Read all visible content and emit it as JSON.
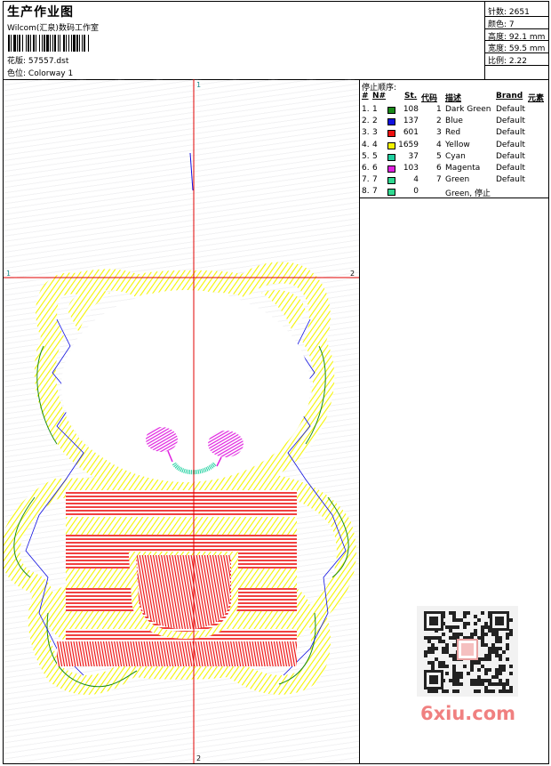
{
  "header": {
    "title": "生产作业图",
    "company": "Wilcom(汇泉)数码工作室",
    "design_label": "花版:",
    "design_value": "57557.dst",
    "color_label": "色位:",
    "color_value": "Colorway 1"
  },
  "stats": [
    {
      "label": "针数:",
      "value": "2651"
    },
    {
      "label": "颜色:",
      "value": "7"
    },
    {
      "label": "高度:",
      "value": "92.1 mm"
    },
    {
      "label": "宽度:",
      "value": "59.5 mm"
    },
    {
      "label": "比例:",
      "value": "2.22"
    }
  ],
  "stop_sequence": {
    "title": "停止顺序:",
    "headers": {
      "num": "#",
      "n": "N#",
      "st": "St.",
      "code": "代码",
      "desc": "描述",
      "brand": "Brand",
      "element": "元素"
    },
    "rows": [
      {
        "num": "1.",
        "n": "1",
        "color": "#1a8a1a",
        "st": "108",
        "code": "1",
        "desc": "Dark Green",
        "brand": "Default"
      },
      {
        "num": "2.",
        "n": "2",
        "color": "#1010e0",
        "st": "137",
        "code": "2",
        "desc": "Blue",
        "brand": "Default"
      },
      {
        "num": "3.",
        "n": "3",
        "color": "#ee1010",
        "st": "601",
        "code": "3",
        "desc": "Red",
        "brand": "Default"
      },
      {
        "num": "4.",
        "n": "4",
        "color": "#f4f400",
        "st": "1659",
        "code": "4",
        "desc": "Yellow",
        "brand": "Default"
      },
      {
        "num": "5.",
        "n": "5",
        "color": "#20d0a0",
        "st": "37",
        "code": "5",
        "desc": "Cyan",
        "brand": "Default"
      },
      {
        "num": "6.",
        "n": "6",
        "color": "#e020e0",
        "st": "103",
        "code": "6",
        "desc": "Magenta",
        "brand": "Default"
      },
      {
        "num": "7.",
        "n": "7",
        "color": "#30d890",
        "st": "4",
        "code": "7",
        "desc": "Green",
        "brand": "Default"
      },
      {
        "num": "8.",
        "n": "7",
        "color": "#30d890",
        "st": "0",
        "code": "",
        "desc": "Green, 停止",
        "brand": ""
      }
    ]
  },
  "axis_labels": {
    "top": "1",
    "left": "1",
    "right": "2",
    "bottom": "2"
  },
  "watermark": "6xiu.com",
  "colors": {
    "axis": "#e00000",
    "yellow": "#f4f400",
    "red": "#ee1010",
    "magenta": "#e020e0",
    "cyan": "#20d0a0",
    "blue": "#1010e0",
    "green": "#1a8a1a"
  }
}
